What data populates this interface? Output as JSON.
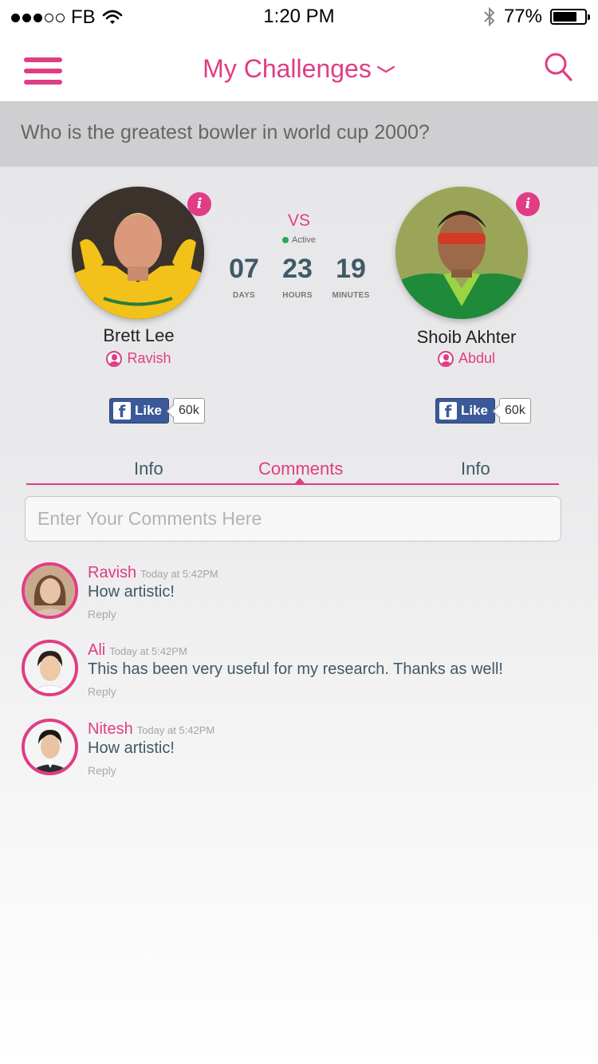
{
  "status_bar": {
    "carrier": "FB",
    "time": "1:20 PM",
    "battery": "77%",
    "battery_level": 0.77,
    "signal_dots_filled": 3,
    "signal_dots_total": 5
  },
  "nav": {
    "title": "My Challenges",
    "menu_icon": "hamburger-menu-icon",
    "search_icon": "search-icon",
    "dropdown_icon": "chevron-down-icon"
  },
  "question": "Who is the greatest bowler in world cup 2000?",
  "versus": {
    "vs_label": "VS",
    "status": "Active",
    "countdown": [
      {
        "value": "07",
        "unit": "DAYS"
      },
      {
        "value": "23",
        "unit": "HOURS"
      },
      {
        "value": "19",
        "unit": "MINUTES"
      }
    ],
    "left": {
      "player": "Brett Lee",
      "backer": "Ravish",
      "likes": "60k",
      "like_label": "Like"
    },
    "right": {
      "player": "Shoib Akhter",
      "backer": "Abdul",
      "likes": "60k",
      "like_label": "Like"
    }
  },
  "tabs": [
    {
      "label": "Info",
      "active": false
    },
    {
      "label": "Comments",
      "active": true
    },
    {
      "label": "Info",
      "active": false
    }
  ],
  "comment_input": {
    "placeholder": "Enter Your Comments Here",
    "value": ""
  },
  "comments": [
    {
      "name": "Ravish",
      "time": "Today at 5:42PM",
      "text": "How artistic!",
      "reply": "Reply"
    },
    {
      "name": "Ali",
      "time": "Today at 5:42PM",
      "text": "This has been very useful for my research. Thanks as well!",
      "reply": "Reply"
    },
    {
      "name": "Nitesh",
      "time": "Today at 5:42PM",
      "text": "How artistic!",
      "reply": "Reply"
    }
  ],
  "colors": {
    "accent": "#e03d84",
    "text_dark": "#3f5a66",
    "facebook": "#3b5998",
    "active_green": "#27a85a"
  }
}
